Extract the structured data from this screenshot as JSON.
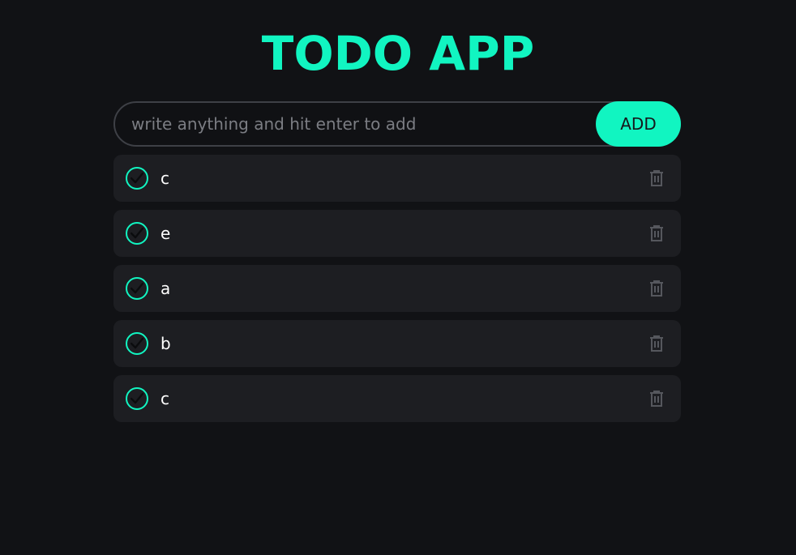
{
  "app": {
    "title": "TODO APP"
  },
  "input": {
    "placeholder": "write anything and hit enter to add",
    "value": ""
  },
  "add_button": {
    "label": "ADD"
  },
  "todos": [
    {
      "text": "c"
    },
    {
      "text": "e"
    },
    {
      "text": "a"
    },
    {
      "text": "b"
    },
    {
      "text": "c"
    }
  ],
  "icons": {
    "check": "check-circle-icon",
    "delete": "trash-icon"
  },
  "colors": {
    "background": "#111215",
    "accent": "#11f5c1",
    "card": "#1d1e22",
    "muted_icon": "#55575d"
  }
}
